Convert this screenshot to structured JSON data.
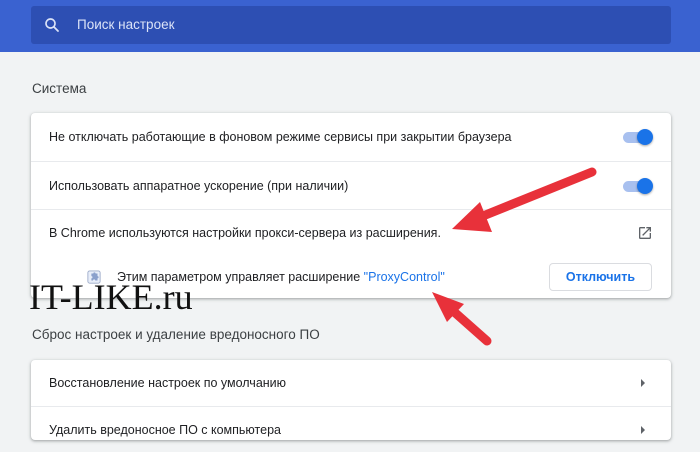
{
  "search": {
    "placeholder": "Поиск настроек",
    "icon": "search-icon"
  },
  "system": {
    "title": "Система",
    "background_label": "Не отключать работающие в фоновом режиме сервисы при закрытии браузера",
    "background_enabled": true,
    "hardware_label": "Использовать аппаратное ускорение (при наличии)",
    "hardware_enabled": true,
    "proxy_label": "В Chrome используются настройки прокси-сервера из расширения.",
    "proxy_icon": "external-link-icon",
    "extension": {
      "text": "Этим параметром управляет расширение ",
      "name": "\"ProxyControl\"",
      "button_label": "Отключить",
      "icon": "puzzle-icon"
    }
  },
  "reset": {
    "title": "Сброс настроек и удаление вредоносного ПО",
    "restore_label": "Восстановление настроек по умолчанию",
    "cleanup_label": "Удалить вредоносное ПО с компьютера"
  },
  "watermark": "IT-LIKE.ru",
  "colors": {
    "header": "#3a62d0",
    "search_box": "#2d4fb3",
    "accent": "#1a73e8",
    "annotation_arrow": "#e8313a"
  }
}
